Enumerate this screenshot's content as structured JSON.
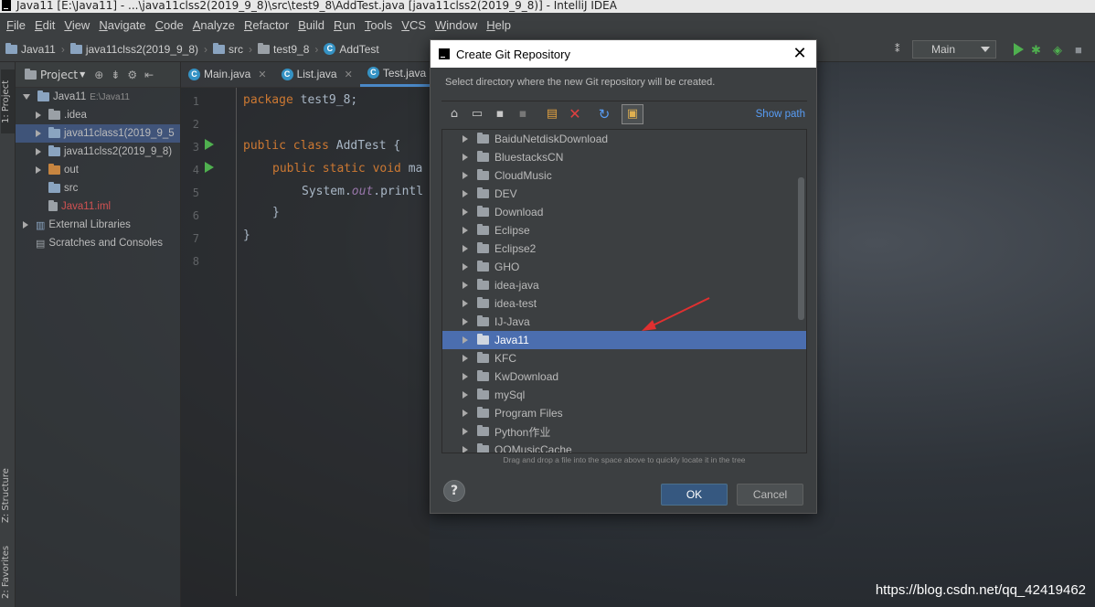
{
  "window": {
    "title": "Java11 [E:\\Java11] - ...\\java11clss2(2019_9_8)\\src\\test9_8\\AddTest.java [java11clss2(2019_9_8)] - IntelliJ IDEA"
  },
  "menu": [
    "File",
    "Edit",
    "View",
    "Navigate",
    "Code",
    "Analyze",
    "Refactor",
    "Build",
    "Run",
    "Tools",
    "VCS",
    "Window",
    "Help"
  ],
  "breadcrumb": [
    "Java11",
    "java11clss2(2019_9_8)",
    "src",
    "test9_8",
    "AddTest"
  ],
  "run_config": "Main",
  "left_stripe": {
    "project_tab": "1: Project",
    "structure_tab": "Z: Structure",
    "favorites_tab": "2: Favorites"
  },
  "project_panel": {
    "header": "Project",
    "tree": [
      {
        "label": "Java11",
        "hint": "E:\\Java11"
      },
      {
        "label": ".idea"
      },
      {
        "label": "java11class1(2019_9_5"
      },
      {
        "label": "java11clss2(2019_9_8)"
      },
      {
        "label": "out"
      },
      {
        "label": "src"
      },
      {
        "label": "Java11.iml"
      },
      {
        "label": "External Libraries"
      },
      {
        "label": "Scratches and Consoles"
      }
    ]
  },
  "editor": {
    "tabs": [
      "Main.java",
      "List.java",
      "Test.java"
    ],
    "line_numbers": [
      "1",
      "2",
      "3",
      "4",
      "5",
      "6",
      "7",
      "8"
    ],
    "code": {
      "l1_kw": "package",
      "l1_rest": " test9_8;",
      "l3_kw": "public class",
      "l3_rest": " AddTest {",
      "l4_kw": "public static void",
      "l4_rest": " ma",
      "l5_a": "System.",
      "l5_it": "out",
      "l5_b": ".printl",
      "l6": "}",
      "l7": "}"
    }
  },
  "dialog": {
    "title": "Create Git Repository",
    "description": "Select directory where the new Git repository will be created.",
    "show_path": "Show path",
    "folders": [
      "BaiduNetdiskDownload",
      "BluestacksCN",
      "CloudMusic",
      "DEV",
      "Download",
      "Eclipse",
      "Eclipse2",
      "GHO",
      "idea-java",
      "idea-test",
      "IJ-Java",
      "Java11",
      "KFC",
      "KwDownload",
      "mySql",
      "Program Files",
      "Python作业",
      "QQMusicCache"
    ],
    "selected_folder": "Java11",
    "drag_hint": "Drag and drop a file into the space above to quickly locate it in the tree",
    "help": "?",
    "ok": "OK",
    "cancel": "Cancel",
    "toolbar_icons": [
      "home-icon",
      "desktop-icon",
      "module-icon",
      "project-icon",
      "new-folder-icon",
      "delete-icon",
      "refresh-icon",
      "toggle-hidden-icon"
    ]
  },
  "watermark": "https://blog.csdn.net/qq_42419462",
  "colors": {
    "selection": "#4b6eaf",
    "ok_button": "#365880",
    "arrow": "#e03030",
    "link": "#589df6"
  }
}
